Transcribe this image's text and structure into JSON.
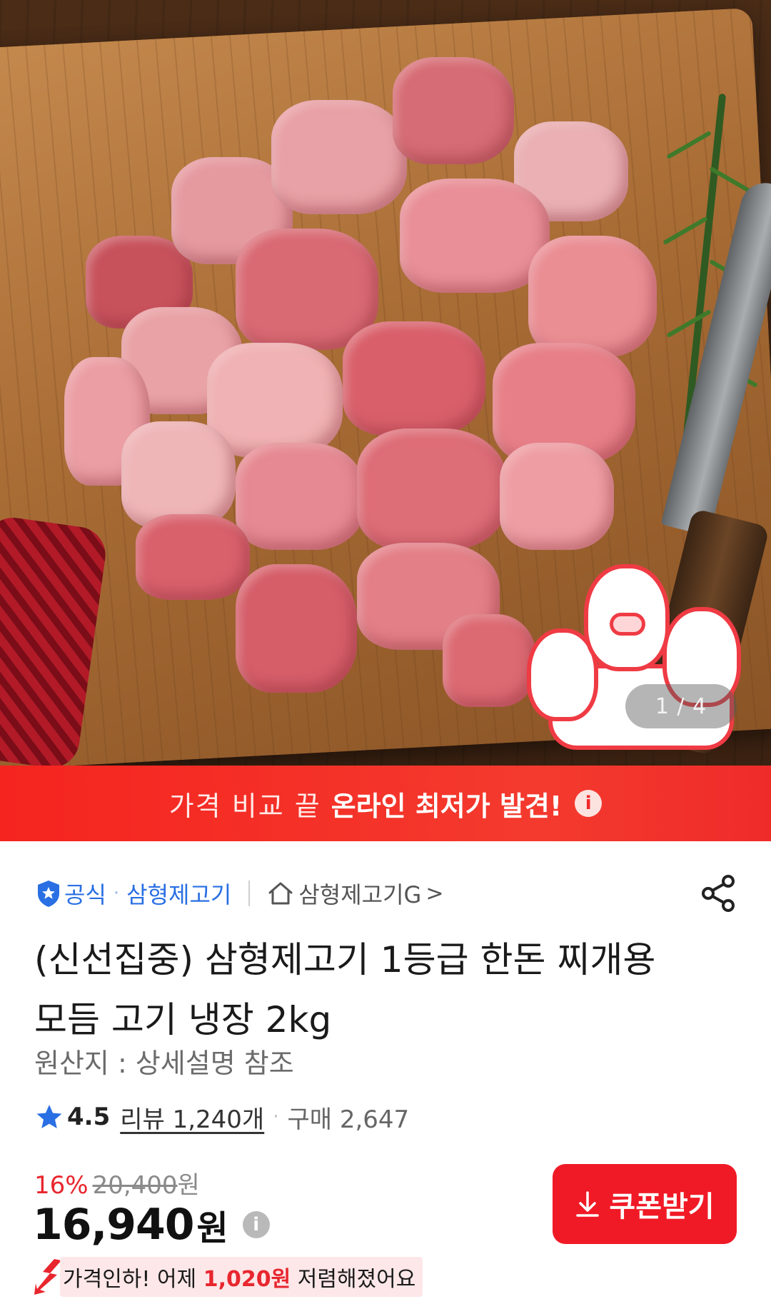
{
  "gallery": {
    "indicator": "1 / 4"
  },
  "banner": {
    "light_text": "가격 비교 끝",
    "bold_text": "온라인 최저가 발견!",
    "info_glyph": "i"
  },
  "seller": {
    "official_label": "공식",
    "separator": "·",
    "brand": "삼형제고기",
    "store": "삼형제고기G",
    "chevron": ">"
  },
  "product": {
    "title": "(신선집중) 삼형제고기 1등급 한돈 찌개용 모듬 고기 냉장 2kg",
    "origin": "원산지 : 상세설명 참조"
  },
  "rating": {
    "value": "4.5",
    "reviews": "리뷰 1,240개",
    "separator": "·",
    "purchases": "구매 2,647"
  },
  "price": {
    "discount": "16%",
    "original": "20,400",
    "original_unit": "원",
    "current": "16,940",
    "current_unit": "원",
    "info_glyph": "i"
  },
  "price_drop": {
    "prefix": "가격인하! 어제 ",
    "amount": "1,020원",
    "suffix": " 저렴해졌어요"
  },
  "coupon": {
    "label": "쿠폰받기"
  },
  "colors": {
    "accent_red": "#f01a26",
    "link_blue": "#2a6fe3"
  }
}
